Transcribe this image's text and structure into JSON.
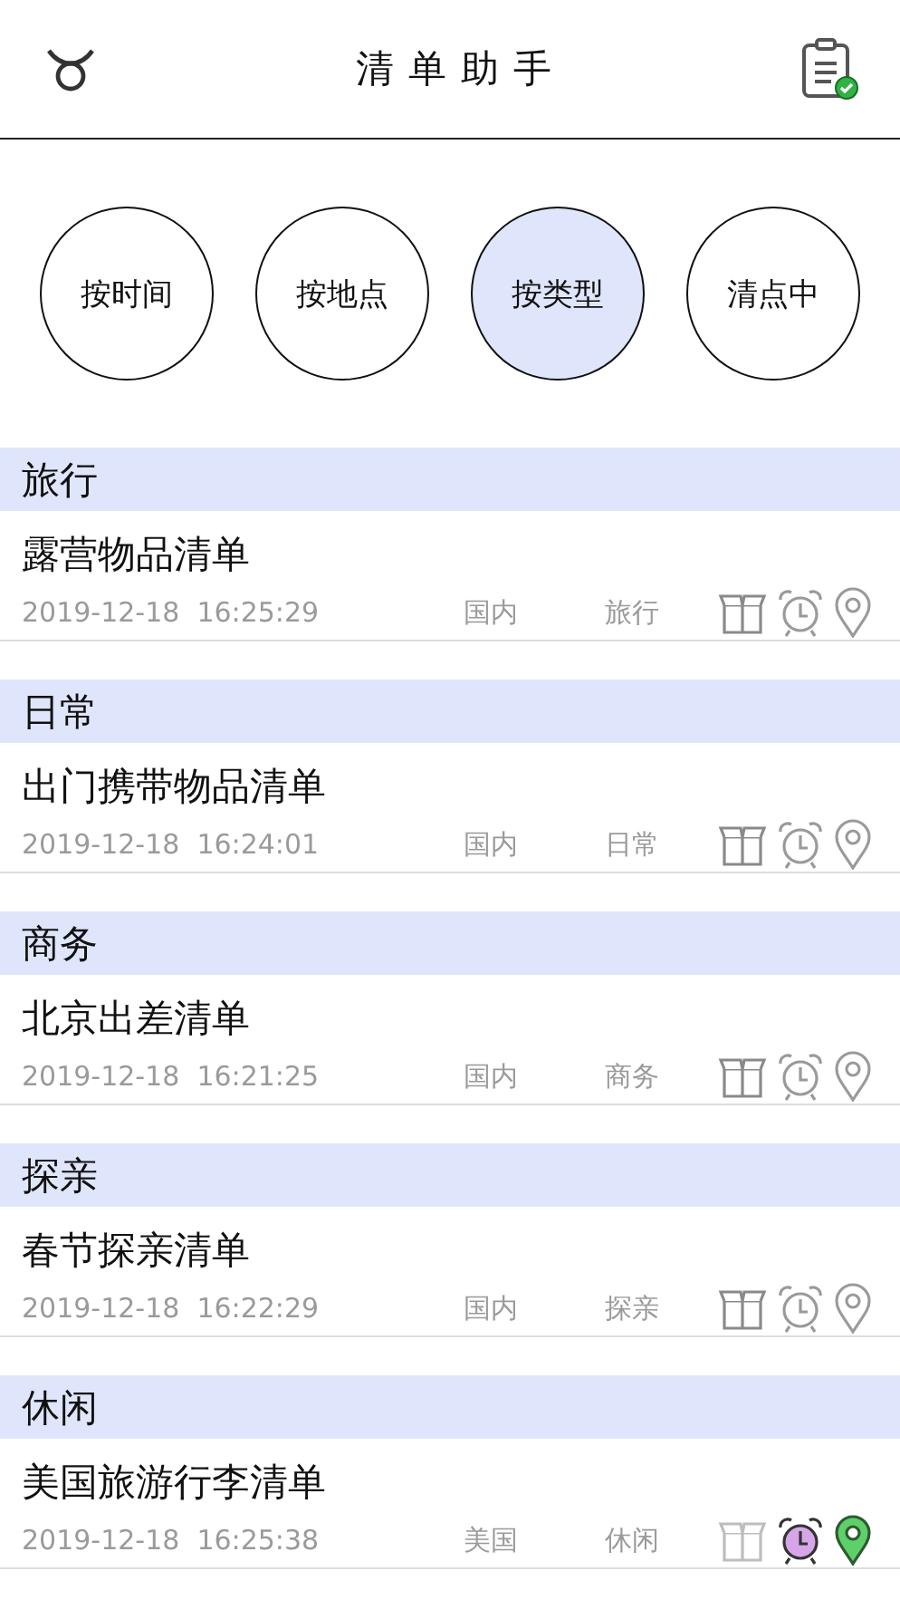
{
  "header": {
    "title": "清单助手",
    "status_checked": true
  },
  "filters": [
    {
      "label": "按时间",
      "selected": false
    },
    {
      "label": "按地点",
      "selected": false
    },
    {
      "label": "按类型",
      "selected": true
    },
    {
      "label": "清点中",
      "selected": false
    }
  ],
  "sections": [
    {
      "title": "旅行",
      "items": [
        {
          "name": "露营物品清单",
          "date": "2019-12-18  16:25:29",
          "place": "国内",
          "category": "旅行",
          "packed": true,
          "alarm": false,
          "location": false
        }
      ]
    },
    {
      "title": "日常",
      "items": [
        {
          "name": "出门携带物品清单",
          "date": "2019-12-18  16:24:01",
          "place": "国内",
          "category": "日常",
          "packed": true,
          "alarm": false,
          "location": false
        }
      ]
    },
    {
      "title": "商务",
      "items": [
        {
          "name": "北京出差清单",
          "date": "2019-12-18  16:21:25",
          "place": "国内",
          "category": "商务",
          "packed": true,
          "alarm": false,
          "location": false
        }
      ]
    },
    {
      "title": "探亲",
      "items": [
        {
          "name": "春节探亲清单",
          "date": "2019-12-18  16:22:29",
          "place": "国内",
          "category": "探亲",
          "packed": true,
          "alarm": false,
          "location": false
        }
      ]
    },
    {
      "title": "休闲",
      "items": [
        {
          "name": "美国旅游行李清单",
          "date": "2019-12-18  16:25:38",
          "place": "美国",
          "category": "休闲",
          "packed": false,
          "alarm": true,
          "location": true
        }
      ]
    }
  ]
}
